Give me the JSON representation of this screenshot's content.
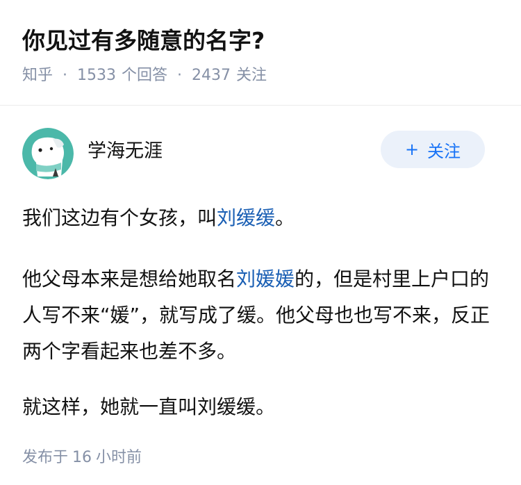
{
  "question": {
    "title": "你见过有多随意的名字?",
    "source": "知乎",
    "answers_count": "1533",
    "answers_label": "个回答",
    "followers_count": "2437",
    "followers_label": "关注"
  },
  "author": {
    "name": "学海无涯",
    "follow_plus": "+",
    "follow_label": "关注"
  },
  "content": {
    "p1_a": "我们这边有个女孩，叫",
    "p1_link": "刘缓缓",
    "p1_b": "。",
    "p2_a": "他父母本来是想给她取名",
    "p2_link": "刘媛媛",
    "p2_b": "的，但是村里上户口的人写不来“媛”，就写成了缓。他父母也也写不来，反正两个字看起来也差不多。",
    "p3": "就这样，她就一直叫刘缓缓。"
  },
  "footer": {
    "prefix": "发布于",
    "number": "16",
    "suffix": "小时前"
  },
  "colors": {
    "accent": "#1772f6",
    "link": "#1a5fb4",
    "meta": "#8590a6",
    "avatar_bg": "#4bb8a9"
  }
}
